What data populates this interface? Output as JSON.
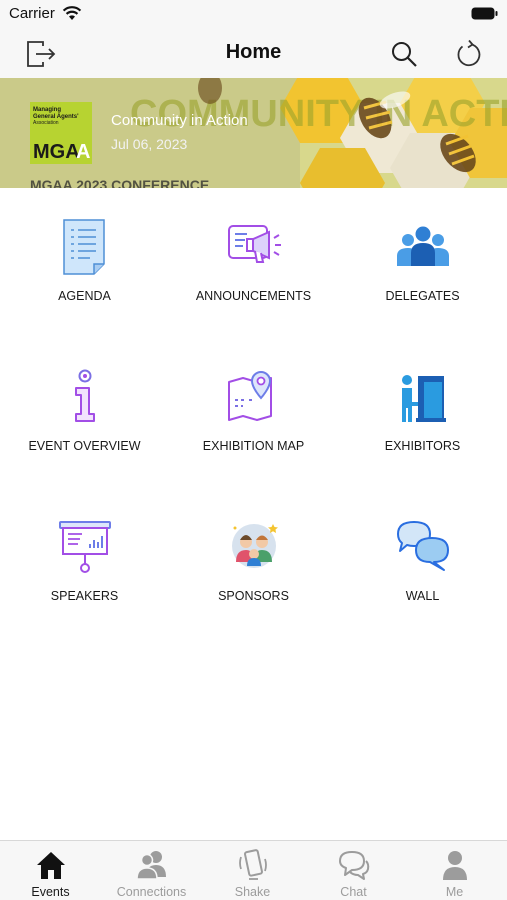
{
  "status_bar": {
    "carrier": "Carrier"
  },
  "nav": {
    "title": "Home"
  },
  "banner": {
    "event_title": "Community in Action",
    "event_date": "Jul 06, 2023",
    "logo_text": "MGAA",
    "logo_subtext": "Managing General Agents' Association",
    "bg_headline": "COMMUNITY IN ACTION",
    "bg_caption": "MGAA 2023 CONFERENCE"
  },
  "menu": [
    {
      "label": "AGENDA",
      "icon": "agenda-icon"
    },
    {
      "label": "ANNOUNCEMENTS",
      "icon": "announcements-icon"
    },
    {
      "label": "DELEGATES",
      "icon": "delegates-icon"
    },
    {
      "label": "EVENT OVERVIEW",
      "icon": "info-icon"
    },
    {
      "label": "EXHIBITION MAP",
      "icon": "map-pin-icon"
    },
    {
      "label": "EXHIBITORS",
      "icon": "exhibitors-icon"
    },
    {
      "label": "SPEAKERS",
      "icon": "presentation-icon"
    },
    {
      "label": "SPONSORS",
      "icon": "sponsors-icon"
    },
    {
      "label": "WALL",
      "icon": "chat-bubbles-icon"
    }
  ],
  "tabs": [
    {
      "label": "Events",
      "active": true
    },
    {
      "label": "Connections",
      "active": false
    },
    {
      "label": "Shake",
      "active": false
    },
    {
      "label": "Chat",
      "active": false
    },
    {
      "label": "Me",
      "active": false
    }
  ],
  "colors": {
    "accent_purple": "#a24ee6",
    "accent_blue": "#2a6ee0",
    "banner_green": "#b7d331",
    "tab_inactive": "#9c9c9c"
  }
}
